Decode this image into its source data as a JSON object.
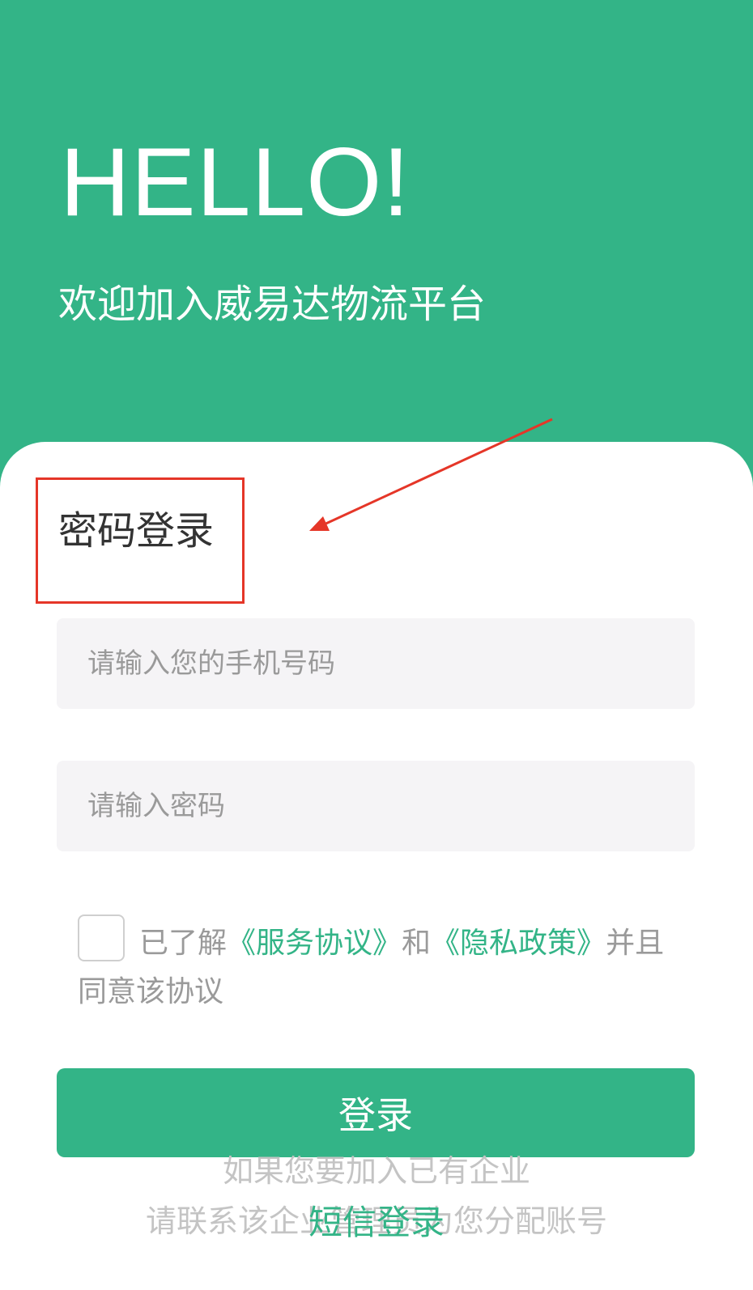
{
  "hero": {
    "greeting": "HELLO!",
    "welcome": "欢迎加入威易达物流平台"
  },
  "login": {
    "section_title": "密码登录",
    "phone_placeholder": "请输入您的手机号码",
    "password_placeholder": "请输入密码",
    "agreement_prefix": "已了解",
    "service_agreement": "《服务协议》",
    "agreement_and": "和",
    "privacy_policy": "《隐私政策》",
    "agreement_suffix": "并且同意该协议",
    "login_button": "登录",
    "enterprise_note_1": "如果您要加入已有企业",
    "enterprise_note_2": "请联系该企业管理员为您分配账号",
    "sms_login": "短信登录"
  },
  "colors": {
    "brand_green": "#33b487",
    "annotation_red": "#e53628"
  }
}
